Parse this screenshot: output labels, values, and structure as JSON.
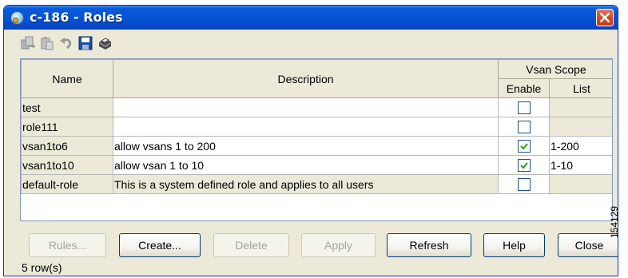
{
  "window": {
    "title": "c-186 - Roles"
  },
  "toolbar": {
    "icons": [
      "copy-icon",
      "paste-icon",
      "undo-icon",
      "save-icon",
      "print-icon"
    ]
  },
  "table": {
    "headers": {
      "name": "Name",
      "description": "Description",
      "vsan_scope": "Vsan Scope",
      "enable": "Enable",
      "list": "List"
    },
    "rows": [
      {
        "name": "test",
        "description": "",
        "enable": false,
        "list": ""
      },
      {
        "name": "role111",
        "description": "",
        "enable": false,
        "list": ""
      },
      {
        "name": "vsan1to6",
        "description": "allow vsans 1 to 200",
        "enable": true,
        "list": "1-200"
      },
      {
        "name": "vsan1to10",
        "description": "allow vsan 1 to 10",
        "enable": true,
        "list": "1-10"
      },
      {
        "name": "default-role",
        "description": "This is a system defined role and applies to all users",
        "enable": false,
        "list": ""
      }
    ]
  },
  "buttons": {
    "rules": "Rules...",
    "create": "Create...",
    "delete": "Delete",
    "apply": "Apply",
    "refresh": "Refresh",
    "help": "Help",
    "close": "Close"
  },
  "status": {
    "row_count": "5 row(s)"
  },
  "figure_id": "154129",
  "colors": {
    "title_bar": "#0654d6",
    "dialog_bg": "#ece9d8",
    "checkmark": "#21a121",
    "close_button": "#d44b26"
  }
}
